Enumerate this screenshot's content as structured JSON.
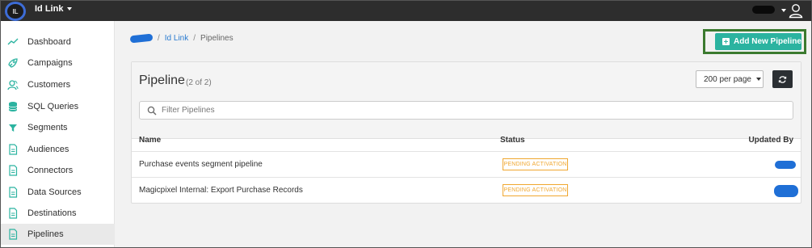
{
  "topbar": {
    "logo_text": "IL",
    "app_menu_label": "Id Link",
    "user_icon": "user-icon"
  },
  "sidebar": {
    "items": [
      {
        "label": "Dashboard",
        "icon": "trend-icon"
      },
      {
        "label": "Campaigns",
        "icon": "rocket-icon"
      },
      {
        "label": "Customers",
        "icon": "customers-icon"
      },
      {
        "label": "SQL Queries",
        "icon": "database-icon"
      },
      {
        "label": "Segments",
        "icon": "filter-icon"
      },
      {
        "label": "Audiences",
        "icon": "document-icon"
      },
      {
        "label": "Connectors",
        "icon": "document-icon"
      },
      {
        "label": "Data Sources",
        "icon": "document-icon"
      },
      {
        "label": "Destinations",
        "icon": "document-icon"
      },
      {
        "label": "Pipelines",
        "icon": "document-icon",
        "active": true
      }
    ]
  },
  "breadcrumb": {
    "link": "Id Link",
    "current": "Pipelines",
    "separator": "/"
  },
  "add_button": {
    "label": "Add New Pipeline"
  },
  "panel": {
    "title": "Pipeline",
    "count": "(2 of 2)",
    "per_page": "200 per page",
    "filter_placeholder": "Filter Pipelines"
  },
  "table": {
    "headers": {
      "name": "Name",
      "status": "Status",
      "updated_by": "Updated By"
    },
    "rows": [
      {
        "name": "Purchase events segment pipeline",
        "status": "PENDING ACTIVATION"
      },
      {
        "name": "Magicpixel Internal: Export Purchase Records",
        "status": "PENDING ACTIVATION"
      }
    ]
  },
  "colors": {
    "topbar": "#2d2d2d",
    "accent": "#2bb3a0",
    "link": "#2a7bd0",
    "status_pending": "#f0a730",
    "highlight_border": "#3b7a2f"
  }
}
